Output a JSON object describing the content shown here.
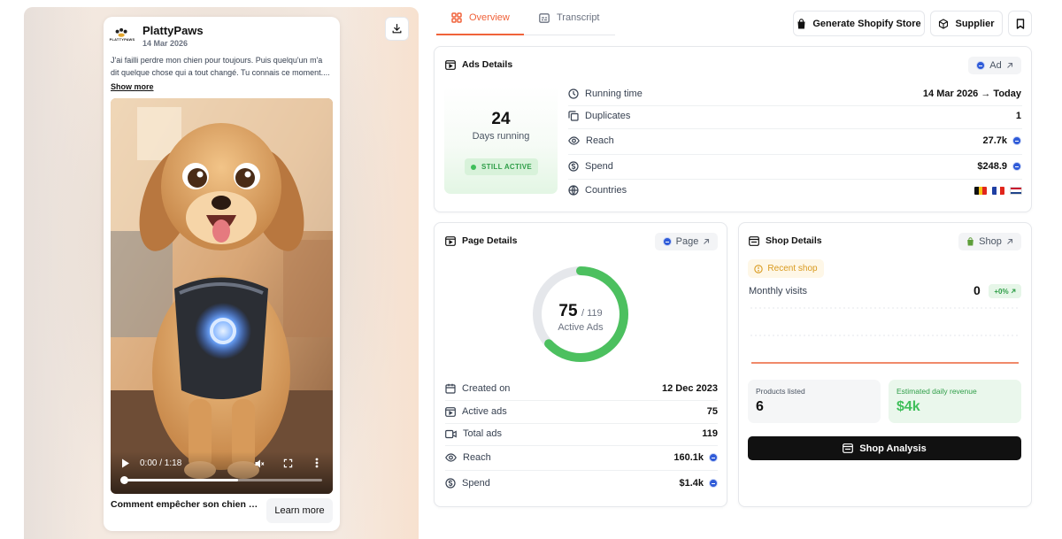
{
  "ad": {
    "brand_name": "PlattyPaws",
    "brand_logo_text": "PLATTYPAWS",
    "date": "14 Mar 2026",
    "text": "J'ai failli perdre mon chien pour toujours. Puis quelqu'un m'a dit quelque chose qui a tout changé. Tu connais ce moment....",
    "show_more": "Show more",
    "video_time": "0:00 / 1:18",
    "video_progress": 0.58,
    "cta_text": "Comment empêcher son chien de fuguer",
    "cta_button": "Learn more"
  },
  "tabs": [
    {
      "label": "Overview",
      "active": true
    },
    {
      "label": "Transcript",
      "active": false
    }
  ],
  "toolbar": {
    "generate_shopify": "Generate Shopify Store",
    "supplier": "Supplier"
  },
  "ads_details": {
    "title": "Ads Details",
    "link_label": "Ad",
    "days_value": "24",
    "days_label": "Days running",
    "status": "STILL ACTIVE",
    "rows": [
      {
        "label": "Running time",
        "value": "14 Mar 2026 → Today"
      },
      {
        "label": "Duplicates",
        "value": "1"
      },
      {
        "label": "Reach",
        "value": "27.7k"
      },
      {
        "label": "Spend",
        "value": "$248.9"
      },
      {
        "label": "Countries",
        "value": ""
      }
    ],
    "countries": [
      "BE",
      "FR",
      "NL"
    ]
  },
  "page_details": {
    "title": "Page Details",
    "link_label": "Page",
    "active_ads": 75,
    "total_ads_denominator": "/ 119",
    "active_ads_label": "Active Ads",
    "active_ratio": 0.63,
    "rows": [
      {
        "label": "Created on",
        "value": "12 Dec 2023"
      },
      {
        "label": "Active ads",
        "value": "75"
      },
      {
        "label": "Total ads",
        "value": "119"
      },
      {
        "label": "Reach",
        "value": "160.1k"
      },
      {
        "label": "Spend",
        "value": "$1.4k"
      }
    ]
  },
  "shop_details": {
    "title": "Shop Details",
    "link_label": "Shop",
    "badge": "Recent shop",
    "monthly_visits_label": "Monthly visits",
    "monthly_visits_value": "0",
    "visits_change": "+0%",
    "products_label": "Products listed",
    "products_value": "6",
    "revenue_label": "Estimated daily revenue",
    "revenue_value": "$4k",
    "analysis_button": "Shop Analysis"
  },
  "colors": {
    "accent": "#f0623a",
    "green": "#3fbf5a",
    "blue_meta": "#2f5bd8",
    "dark_button": "#111111"
  }
}
